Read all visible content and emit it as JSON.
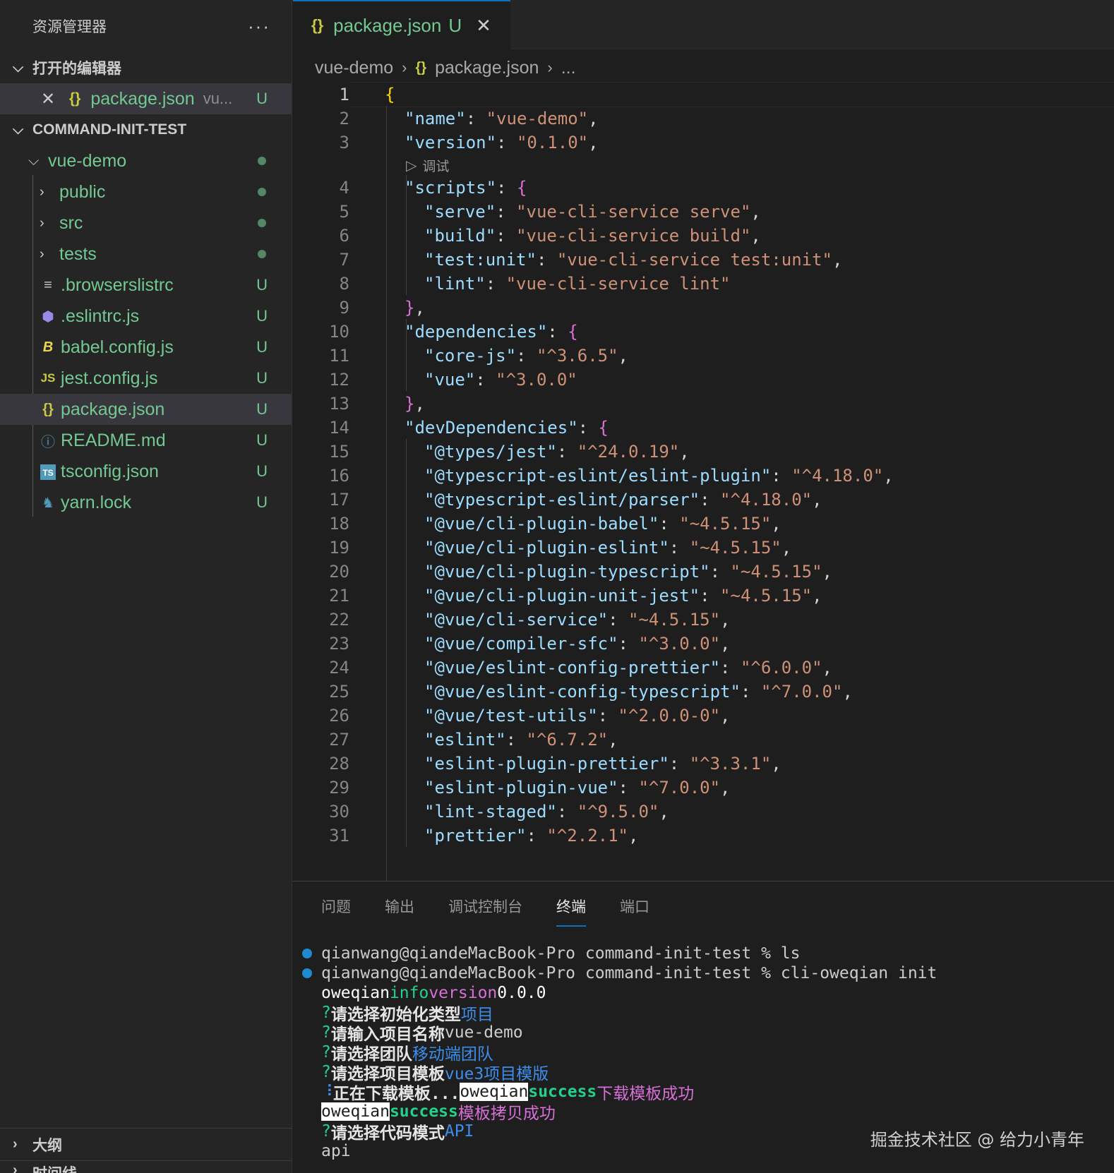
{
  "sidebar": {
    "title": "资源管理器",
    "more": "···",
    "open_editors_label": "打开的编辑器",
    "open_editor_item": {
      "name": "package.json",
      "folder": "vu...",
      "status": "U"
    },
    "workspace_label": "COMMAND-INIT-TEST",
    "root_folder": "vue-demo",
    "items": [
      {
        "name": "public",
        "kind": "folder",
        "status": ""
      },
      {
        "name": "src",
        "kind": "folder",
        "status": ""
      },
      {
        "name": "tests",
        "kind": "folder",
        "status": ""
      },
      {
        "name": ".browserslistrc",
        "kind": "file",
        "icon": "list-icon",
        "status": "U"
      },
      {
        "name": ".eslintrc.js",
        "kind": "file",
        "icon": "eslint-icon",
        "status": "U"
      },
      {
        "name": "babel.config.js",
        "kind": "file",
        "icon": "babel-icon",
        "status": "U"
      },
      {
        "name": "jest.config.js",
        "kind": "file",
        "icon": "js-icon",
        "status": "U"
      },
      {
        "name": "package.json",
        "kind": "file",
        "icon": "json-icon",
        "status": "U"
      },
      {
        "name": "README.md",
        "kind": "file",
        "icon": "info-icon",
        "status": "U"
      },
      {
        "name": "tsconfig.json",
        "kind": "file",
        "icon": "ts-icon",
        "status": "U"
      },
      {
        "name": "yarn.lock",
        "kind": "file",
        "icon": "yarn-icon",
        "status": "U"
      }
    ],
    "outline_label": "大纲",
    "timeline_label": "时间线"
  },
  "tab": {
    "name": "package.json",
    "status": "U"
  },
  "breadcrumb": [
    "vue-demo",
    "package.json",
    "..."
  ],
  "codelens": "调试",
  "code_lines": [
    "{",
    "\"name\": \"vue-demo\",",
    "\"version\": \"0.1.0\",",
    "\"scripts\": {",
    "\"serve\": \"vue-cli-service serve\",",
    "\"build\": \"vue-cli-service build\",",
    "\"test:unit\": \"vue-cli-service test:unit\",",
    "\"lint\": \"vue-cli-service lint\"",
    "},",
    "\"dependencies\": {",
    "\"core-js\": \"^3.6.5\",",
    "\"vue\": \"^3.0.0\"",
    "},",
    "\"devDependencies\": {",
    "\"@types/jest\": \"^24.0.19\",",
    "\"@typescript-eslint/eslint-plugin\": \"^4.18.0\",",
    "\"@typescript-eslint/parser\": \"^4.18.0\",",
    "\"@vue/cli-plugin-babel\": \"~4.5.15\",",
    "\"@vue/cli-plugin-eslint\": \"~4.5.15\",",
    "\"@vue/cli-plugin-typescript\": \"~4.5.15\",",
    "\"@vue/cli-plugin-unit-jest\": \"~4.5.15\",",
    "\"@vue/cli-service\": \"~4.5.15\",",
    "\"@vue/compiler-sfc\": \"^3.0.0\",",
    "\"@vue/eslint-config-prettier\": \"^6.0.0\",",
    "\"@vue/eslint-config-typescript\": \"^7.0.0\",",
    "\"@vue/test-utils\": \"^2.0.0-0\",",
    "\"eslint\": \"^6.7.2\",",
    "\"eslint-plugin-prettier\": \"^3.3.1\",",
    "\"eslint-plugin-vue\": \"^7.0.0\",",
    "\"lint-staged\": \"^9.5.0\",",
    "\"prettier\": \"^2.2.1\","
  ],
  "panel_tabs": [
    "问题",
    "输出",
    "调试控制台",
    "终端",
    "端口"
  ],
  "panel_active": 3,
  "terminal": {
    "prompt1": "qianwang@qiandeMacBook-Pro command-init-test % ls",
    "prompt2": "qianwang@qiandeMacBook-Pro command-init-test % cli-oweqian init",
    "l3_a": "oweqian",
    "l3_b": "info",
    "l3_c": "version",
    "l3_d": "0.0.0",
    "q1": "请选择初始化类型",
    "a1": "项目",
    "q2": "请输入项目名称",
    "a2": "vue-demo",
    "q3": "请选择团队",
    "a3": "移动端团队",
    "q4": "请选择项目模板",
    "a4": "vue3项目模版",
    "dl_spin": "⠸",
    "dl_text": "正在下载模板...",
    "dl_name": "oweqian",
    "dl_success": "success",
    "dl_msg": "下载模板成功",
    "cp_name": "oweqian",
    "cp_success": "success",
    "cp_msg": "模板拷贝成功",
    "q5": "请选择代码模式",
    "a5": "API",
    "last_line": "api",
    "qmark": "?"
  },
  "watermark": "掘金技术社区 @ 给力小青年"
}
